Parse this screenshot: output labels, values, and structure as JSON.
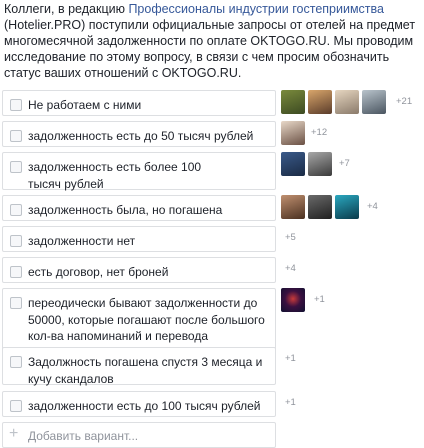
{
  "intro": {
    "pre": "Коллеги, в редакцию ",
    "link": "Профессионалы индустрии гостеприимства",
    "post": " (Hotelier.PRO) поступили официальные запросы от отелей на предмет многомесячной задолженности по оплате OKTOGO.RU. Мы проводим исследование по этому вопросу, в связи с чем просим обозначить статус ваших отношений с OKTOGO.RU."
  },
  "options": [
    {
      "label": "Не работаем с ними",
      "more": "+21"
    },
    {
      "label": "задолженность есть до 50 тысяч рублей",
      "more": "+12"
    },
    {
      "label": "задолженность есть более 100 тысяч рублей",
      "more": "+7"
    },
    {
      "label": "задолженность была, но погашена",
      "more": "+4"
    },
    {
      "label": "задолженности нет",
      "more": "+5"
    },
    {
      "label": "есть договор, нет броней",
      "more": "+4"
    },
    {
      "label": "переодически бывают задолженности до 50000, которые погашают после большого кол-ва напоминаний и перевода бронирований на нал",
      "more": "+1"
    },
    {
      "label": "Задолжность погашена спустя 3 месяца и кучу скандалов",
      "more": "+1"
    },
    {
      "label": "задолженности есть до 100 тысяч рублей",
      "more": "+1"
    }
  ],
  "add_option": "Добавить вариант...",
  "colors": {
    "link": "#365899",
    "border": "#dddfe2",
    "muted": "#90949c"
  }
}
